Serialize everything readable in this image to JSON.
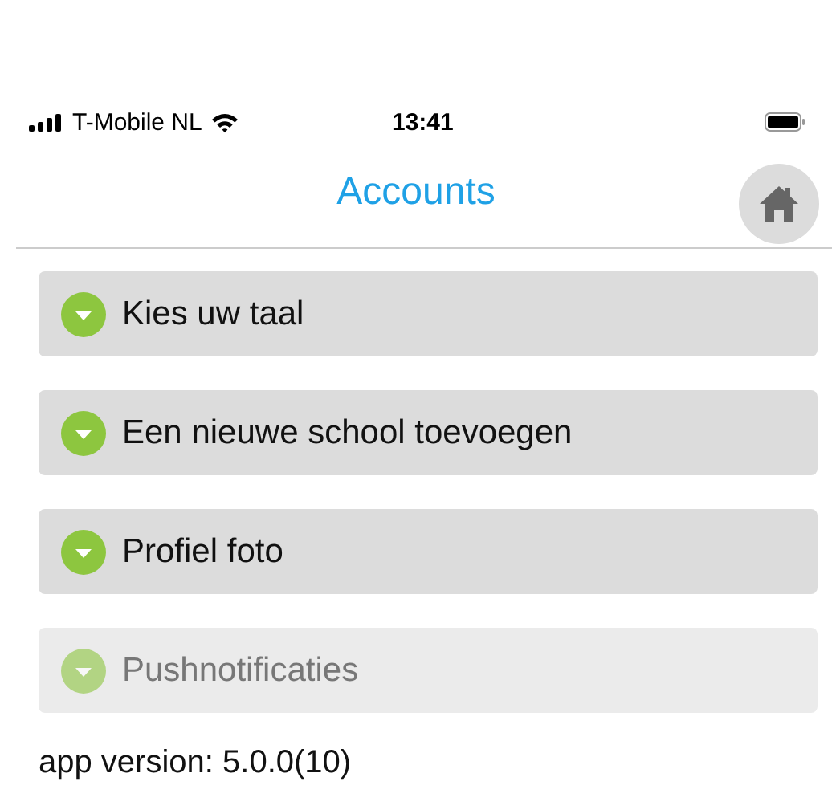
{
  "status_bar": {
    "carrier": "T-Mobile NL",
    "time": "13:41"
  },
  "nav": {
    "title": "Accounts"
  },
  "sections": [
    {
      "label": "Kies uw taal",
      "disabled": false
    },
    {
      "label": "Een nieuwe school toevoegen",
      "disabled": false
    },
    {
      "label": "Profiel foto",
      "disabled": false
    },
    {
      "label": "Pushnotificaties",
      "disabled": true
    }
  ],
  "footer": {
    "version": "app version: 5.0.0(10)"
  }
}
